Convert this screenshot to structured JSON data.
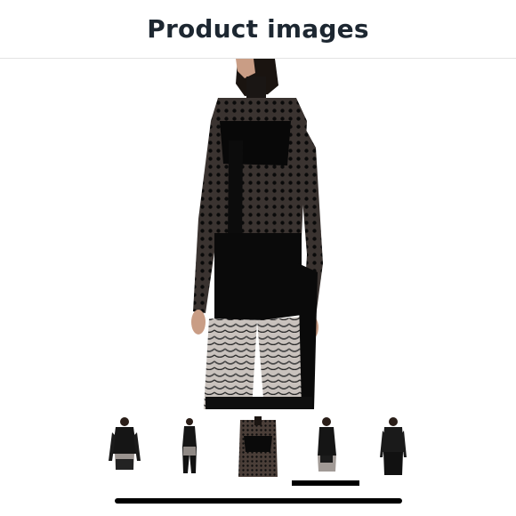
{
  "header": {
    "title": "Product images"
  },
  "gallery": {
    "main_image": {
      "icon": "model-sheer-polka-dot-top-photo"
    },
    "thumbnails": [
      {
        "icon": "thumbnail-front-view"
      },
      {
        "icon": "thumbnail-full-length-view"
      },
      {
        "icon": "thumbnail-fabric-closeup"
      },
      {
        "icon": "thumbnail-side-view"
      },
      {
        "icon": "thumbnail-back-view"
      }
    ],
    "current_index": 4,
    "total": 5
  },
  "colors": {
    "title": "#1d2731",
    "garment": "#0b0b0b",
    "indicator": "#000000"
  }
}
